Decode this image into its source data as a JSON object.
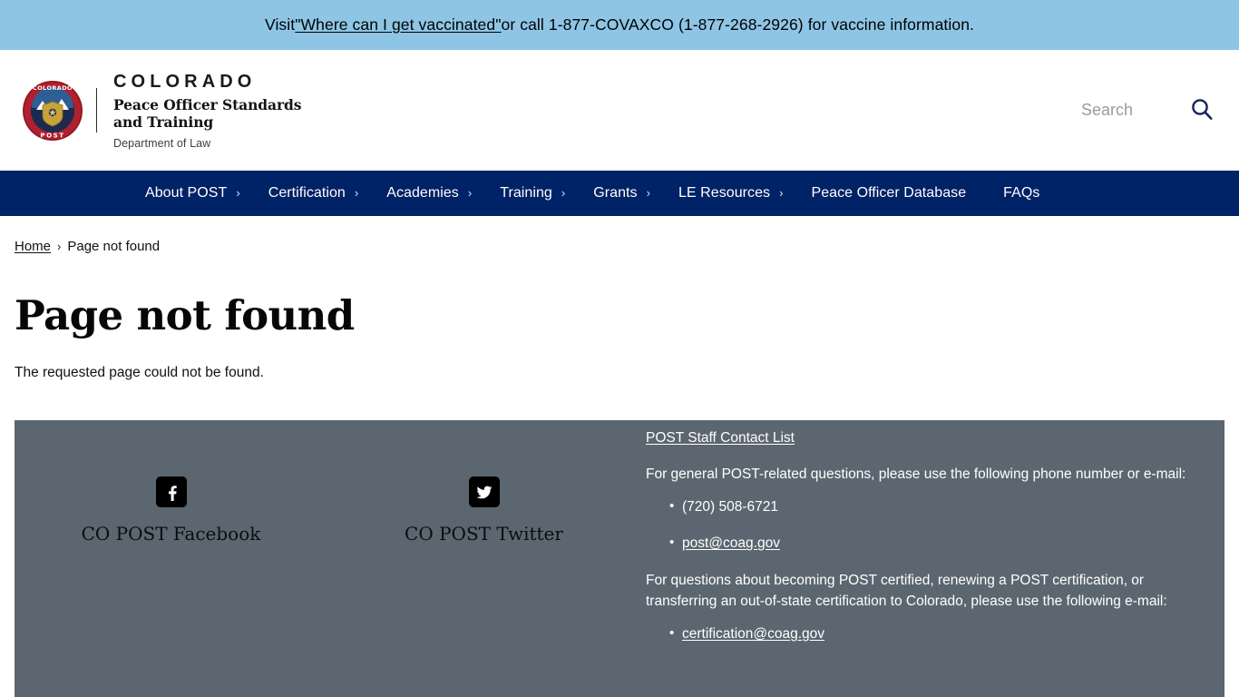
{
  "alert": {
    "prefix": "Visit ",
    "link_text": "\"Where can I get vaccinated\"",
    "suffix": " or call 1-877-COVAXCO (1-877-268-2926) for vaccine information."
  },
  "header": {
    "seal_top_text": "COLORADO",
    "seal_bottom_text": "POST",
    "state": "COLORADO",
    "agency": "Peace Officer Standards and Training",
    "department": "Department of Law",
    "search": {
      "placeholder": "Search",
      "value": "",
      "icon": "search-icon"
    }
  },
  "nav": {
    "items": [
      {
        "label": "About POST",
        "has_children": true
      },
      {
        "label": "Certification",
        "has_children": true
      },
      {
        "label": "Academies",
        "has_children": true
      },
      {
        "label": "Training",
        "has_children": true
      },
      {
        "label": "Grants",
        "has_children": true
      },
      {
        "label": "LE Resources",
        "has_children": true
      },
      {
        "label": "Peace Officer Database",
        "has_children": false
      },
      {
        "label": "FAQs",
        "has_children": false
      }
    ]
  },
  "breadcrumb": {
    "home": "Home",
    "separator": "›",
    "current": "Page not found"
  },
  "main": {
    "title": "Page not found",
    "body": "The requested page could not be found."
  },
  "footer": {
    "social": [
      {
        "icon": "facebook-icon",
        "label": "CO POST Facebook"
      },
      {
        "icon": "twitter-icon",
        "label": "CO POST Twitter"
      }
    ],
    "contact": {
      "staff_list_link": "POST Staff Contact List",
      "general_text": "For general POST-related questions, please use the following phone number or e-mail:",
      "general_items": [
        {
          "text": "(720) 508-6721",
          "is_link": false
        },
        {
          "text": "post@coag.gov",
          "is_link": true
        }
      ],
      "certification_text": "For questions about becoming POST certified, renewing a POST certification, or transferring an out-of-state certification to Colorado, please use the following e-mail:",
      "certification_items": [
        {
          "text": "certification@coag.gov",
          "is_link": true
        }
      ]
    }
  },
  "colors": {
    "alert_bg": "#8ec5e5",
    "nav_bg": "#002266",
    "footer_bg": "#5c6670",
    "seal_red": "#b0202e",
    "seal_navy": "#1c2a52"
  }
}
